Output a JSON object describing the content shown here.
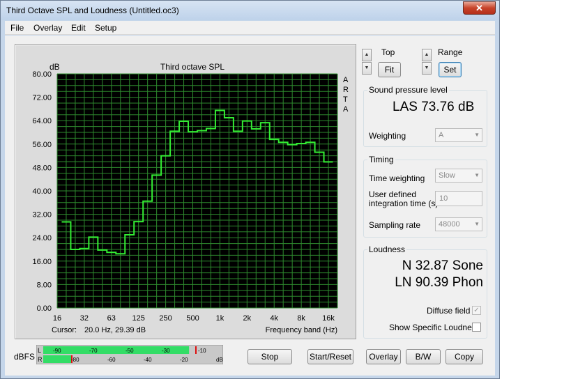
{
  "window": {
    "title": "Third Octave SPL and Loudness (Untitled.oc3)",
    "close_glyph": "✕"
  },
  "menu": {
    "file": "File",
    "overlay": "Overlay",
    "edit": "Edit",
    "setup": "Setup"
  },
  "chart": {
    "unit": "dB",
    "title": "Third octave SPL",
    "brand": [
      "A",
      "R",
      "T",
      "A"
    ],
    "cursor_label": "Cursor:",
    "cursor_value": "20.0 Hz, 29.39 dB",
    "x_caption": "Frequency band (Hz)"
  },
  "chart_data": {
    "type": "line",
    "title": "Third octave SPL",
    "ylabel": "dB",
    "xlabel": "Frequency band (Hz)",
    "ylim": [
      0,
      80
    ],
    "grid": true,
    "y_ticks": [
      "80.00",
      "72.00",
      "64.00",
      "56.00",
      "48.00",
      "40.00",
      "32.00",
      "24.00",
      "16.00",
      "8.00",
      "0.00"
    ],
    "x_ticks": [
      "16",
      "32",
      "63",
      "125",
      "250",
      "500",
      "1k",
      "2k",
      "4k",
      "8k",
      "16k"
    ],
    "series": [
      {
        "x": [
          "20",
          "25",
          "31.5",
          "40",
          "50",
          "63",
          "80",
          "100",
          "125",
          "160",
          "200",
          "250",
          "315",
          "400",
          "500",
          "630",
          "800",
          "1k",
          "1.25k",
          "1.6k",
          "2k",
          "2.5k",
          "3.15k",
          "4k",
          "5k",
          "6.3k",
          "8k",
          "10k",
          "12.5k",
          "16k"
        ],
        "values": [
          29.4,
          20.0,
          20.3,
          24.2,
          19.8,
          19.0,
          18.5,
          25.0,
          29.5,
          36.5,
          45.4,
          52.0,
          60.4,
          63.8,
          60.2,
          60.6,
          61.3,
          67.5,
          65.0,
          60.4,
          63.9,
          61.2,
          63.3,
          57.6,
          56.6,
          55.8,
          56.2,
          56.6,
          53.2,
          49.9
        ],
        "color": "#33ee33"
      }
    ]
  },
  "controls": {
    "top_label": "Top",
    "fit_label": "Fit",
    "range_label": "Range",
    "set_label": "Set",
    "spin_up": "▲",
    "spin_down": "▼"
  },
  "spl": {
    "group_title": "Sound pressure level",
    "value": "LAS 73.76 dB",
    "weighting_label": "Weighting",
    "weighting_value": "A"
  },
  "timing": {
    "group_title": "Timing",
    "time_weighting_label": "Time weighting",
    "time_weighting_value": "Slow",
    "user_defined_line1": "User defined",
    "user_defined_line2": "integration time (s)",
    "integration_value": "10",
    "sampling_rate_label": "Sampling rate",
    "sampling_rate_value": "48000",
    "dropdown_arrow": "▼"
  },
  "loudness": {
    "group_title": "Loudness",
    "sone_value": "N 32.87 Sone",
    "phon_value": "LN 90.39 Phon",
    "diffuse_label": "Diffuse field",
    "diffuse_check": "✓",
    "specific_label": "Show Specific Loudness"
  },
  "meter": {
    "label": "dBFS",
    "l_channel": "L",
    "r_channel": "R",
    "l_ticks": [
      "-90",
      "-70",
      "-50",
      "-30",
      "-10",
      "dB"
    ],
    "r_ticks": [
      "-80",
      "-60",
      "-40",
      "-20",
      "dB"
    ],
    "l_level_fraction": 0.83,
    "r_level_fraction": 0.16,
    "accent": "#33dd66"
  },
  "buttons": {
    "stop": "Stop",
    "start_reset": "Start/Reset",
    "overlay": "Overlay",
    "bw": "B/W",
    "copy": "Copy"
  }
}
